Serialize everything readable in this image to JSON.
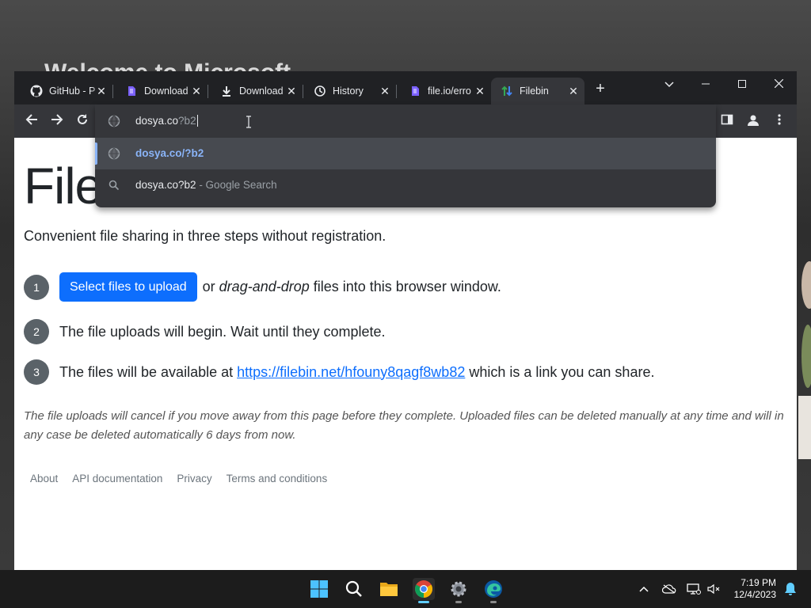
{
  "desktop": {
    "background_title": "Welcome to Microsoft"
  },
  "browser": {
    "tabs": [
      {
        "label": "GitHub - P",
        "icon": "github-icon"
      },
      {
        "label": "Download",
        "icon": "purple-app-icon"
      },
      {
        "label": "Download",
        "icon": "download-icon"
      },
      {
        "label": "History",
        "icon": "history-icon"
      },
      {
        "label": "file.io/erro",
        "icon": "purple-app-icon"
      },
      {
        "label": "Filebin",
        "icon": "filebin-icon",
        "active": true
      }
    ],
    "omnibox": {
      "typed": "dosya.co",
      "autocomplete": "?b2",
      "suggestions": [
        {
          "text": "dosya.co/?b2",
          "sub": "",
          "icon": "globe-icon"
        },
        {
          "text": "dosya.co?b2",
          "sub": " - Google Search",
          "icon": "search-icon"
        }
      ]
    }
  },
  "page": {
    "title": "Files",
    "lead": "Convenient file sharing in three steps without registration.",
    "step1": {
      "num": "1",
      "button": "Select files to upload",
      "or": "or ",
      "em": "drag-and-drop",
      "rest": " files into this browser window."
    },
    "step2": {
      "num": "2",
      "text": "The file uploads will begin. Wait until they complete."
    },
    "step3": {
      "num": "3",
      "pre": "The files will be available at ",
      "link": "https://filebin.net/hfouny8qagf8wb82",
      "post": " which is a link you can share."
    },
    "note": "The file uploads will cancel if you move away from this page before they complete. Uploaded files can be deleted manually at any time and will in any case be deleted automatically 6 days from now.",
    "footer": [
      "About",
      "API documentation",
      "Privacy",
      "Terms and conditions"
    ]
  },
  "taskbar": {
    "time": "7:19 PM",
    "date": "12/4/2023"
  },
  "colors": {
    "accent": "#0d6efd",
    "omni_highlight": "#8ab4f8",
    "tab_bg": "#202124",
    "toolbar_bg": "#35363a"
  }
}
